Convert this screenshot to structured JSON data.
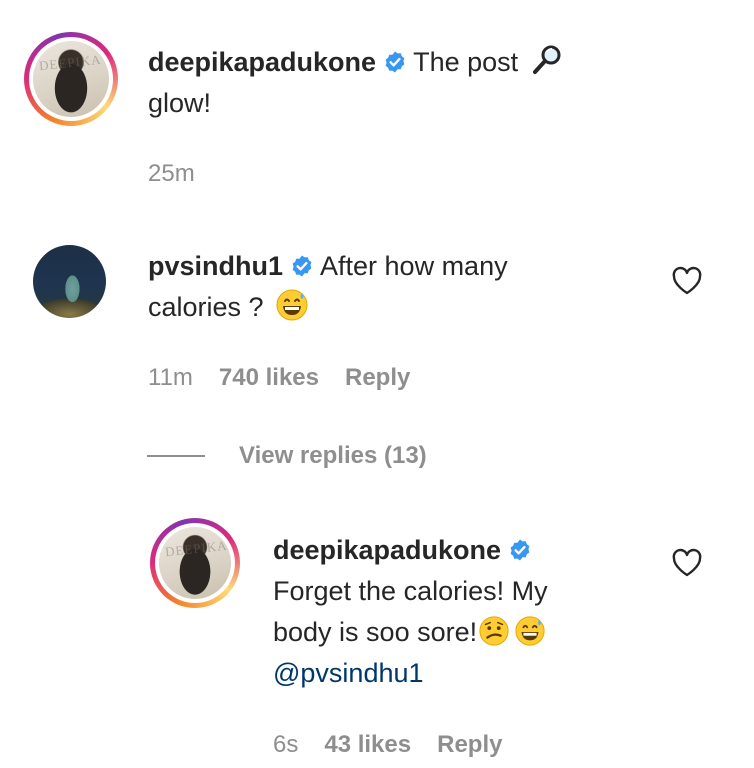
{
  "comments": [
    {
      "username": "deepikapadukone",
      "text": "The post",
      "text_cont": "glow!",
      "emoji": "magnifying-glass-tilted-right",
      "time": "25m",
      "avatar_watermark": "DEEPIKA"
    },
    {
      "username": "pvsindhu1",
      "text": "After how many",
      "text_cont": "calories ?",
      "emoji": "grinning-face-with-sweat",
      "time": "11m",
      "likes": "740 likes",
      "reply": "Reply"
    }
  ],
  "view_replies": "View replies (13)",
  "reply": {
    "username": "deepikapadukone",
    "line1": "Forget the calories! My",
    "line2": "body is soo sore!",
    "emojis": [
      "confused-face",
      "grinning-face-with-sweat"
    ],
    "mention": "@pvsindhu1",
    "time": "6s",
    "likes": "43 likes",
    "reply_label": "Reply",
    "avatar_watermark": "DEEPIKA"
  },
  "colors": {
    "text": "#262626",
    "meta": "#8e8e8e",
    "verified": "#3897f0",
    "mention": "#00376b"
  }
}
